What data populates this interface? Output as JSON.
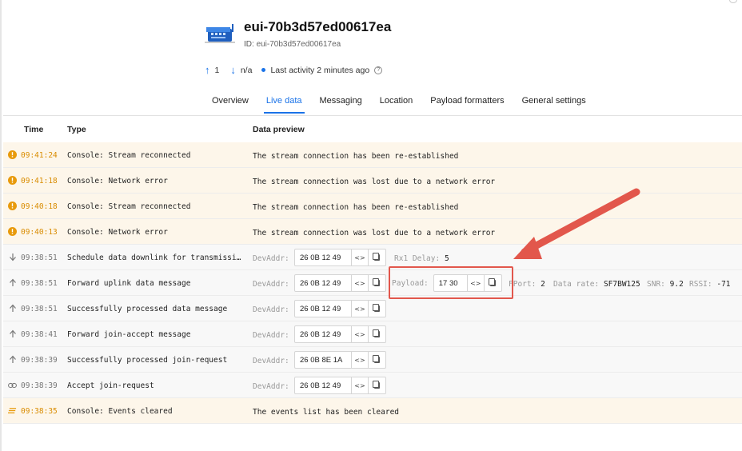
{
  "device": {
    "title": "eui-70b3d57ed00617ea",
    "id_label": "ID:",
    "id_value": "eui-70b3d57ed00617ea",
    "uplink_count": "1",
    "downlink_count": "n/a",
    "last_activity": "Last activity 2 minutes ago"
  },
  "tabs": [
    {
      "label": "Overview"
    },
    {
      "label": "Live data"
    },
    {
      "label": "Messaging"
    },
    {
      "label": "Location"
    },
    {
      "label": "Payload formatters"
    },
    {
      "label": "General settings"
    }
  ],
  "table": {
    "headers": {
      "time": "Time",
      "type": "Type",
      "preview": "Data preview"
    },
    "devaddr_label": "DevAddr:",
    "payload_label": "Payload:",
    "rows": [
      {
        "time": "09:41:24",
        "type": "Console: Stream reconnected",
        "preview": "The stream connection has been re-established"
      },
      {
        "time": "09:41:18",
        "type": "Console: Network error",
        "preview": "The stream connection was lost due to a network error"
      },
      {
        "time": "09:40:18",
        "type": "Console: Stream reconnected",
        "preview": "The stream connection has been re-established"
      },
      {
        "time": "09:40:13",
        "type": "Console: Network error",
        "preview": "The stream connection was lost due to a network error"
      },
      {
        "time": "09:38:51",
        "type": "Schedule data downlink for transmissi…",
        "devaddr": "26 0B 12 49",
        "rx1_label": "Rx1 Delay:",
        "rx1_value": "5"
      },
      {
        "time": "09:38:51",
        "type": "Forward uplink data message",
        "devaddr": "26 0B 12 49",
        "payload": "17 30",
        "fport_label": "FPort:",
        "fport_value": "2",
        "datarate_label": "Data rate:",
        "datarate_value": "SF7BW125",
        "snr_label": "SNR:",
        "snr_value": "9.2",
        "rssi_label": "RSSI:",
        "rssi_value": "-71"
      },
      {
        "time": "09:38:51",
        "type": "Successfully processed data message",
        "devaddr": "26 0B 12 49"
      },
      {
        "time": "09:38:41",
        "type": "Forward join-accept message",
        "devaddr": "26 0B 12 49"
      },
      {
        "time": "09:38:39",
        "type": "Successfully processed join-request",
        "devaddr": "26 0B 8E 1A"
      },
      {
        "time": "09:38:39",
        "type": "Accept join-request",
        "devaddr": "26 0B 12 49"
      },
      {
        "time": "09:38:35",
        "type": "Console: Events cleared",
        "preview": "The events list has been cleared"
      }
    ]
  },
  "colors": {
    "accent": "#1a73e8",
    "warning": "#e89a0c",
    "callout": "#e2574c",
    "warn_row_bg": "#fdf6ea"
  }
}
